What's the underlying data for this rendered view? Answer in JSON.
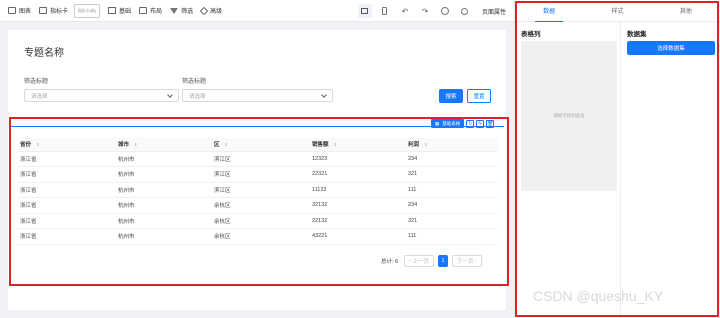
{
  "toolbar": {
    "items": [
      {
        "icon": "chart-icon",
        "label": "图表"
      },
      {
        "icon": "indicator-card-icon",
        "label": "指标卡"
      },
      {
        "icon": "basic-icon",
        "label": "基础"
      },
      {
        "icon": "layout-icon",
        "label": "布局"
      },
      {
        "icon": "filter-icon",
        "label": "筛选"
      },
      {
        "icon": "advanced-icon",
        "label": "高级"
      }
    ],
    "card_preview_label": "指标卡(新)",
    "page_props_label": "页面属性"
  },
  "page": {
    "title": "专题名称",
    "filter1": {
      "label": "筛选标题",
      "placeholder": "请选择"
    },
    "filter2": {
      "label": "筛选标题",
      "placeholder": "请选择"
    },
    "search_label": "搜索",
    "reset_label": "重置"
  },
  "table_tools": {
    "chip_label": "基础表格"
  },
  "table": {
    "columns": [
      "省份",
      "城市",
      "区",
      "销售额",
      "利润"
    ],
    "rows": [
      [
        "浙江省",
        "杭州市",
        "滨江区",
        "12323",
        "234"
      ],
      [
        "浙江省",
        "杭州市",
        "滨江区",
        "22321",
        "321"
      ],
      [
        "浙江省",
        "杭州市",
        "滨江区",
        "11123",
        "111"
      ],
      [
        "浙江省",
        "杭州市",
        "余杭区",
        "32132",
        "234"
      ],
      [
        "浙江省",
        "杭州市",
        "余杭区",
        "22132",
        "321"
      ],
      [
        "浙江省",
        "杭州市",
        "余杭区",
        "43221",
        "111"
      ]
    ]
  },
  "pager": {
    "total": "总计: 6",
    "prev": "上一页",
    "current": "1",
    "next": "下一页"
  },
  "panel": {
    "tabs": [
      "数据",
      "样式",
      "其他"
    ],
    "table_cols_title": "表格列",
    "dropzone_hint": "请拖字段到此处",
    "dataset_title": "数据集",
    "select_dataset_label": "选择数据集"
  },
  "watermark": "CSDN @queshu_KY",
  "colors": {
    "accent": "#1677ff",
    "highlight": "#e0202a"
  }
}
